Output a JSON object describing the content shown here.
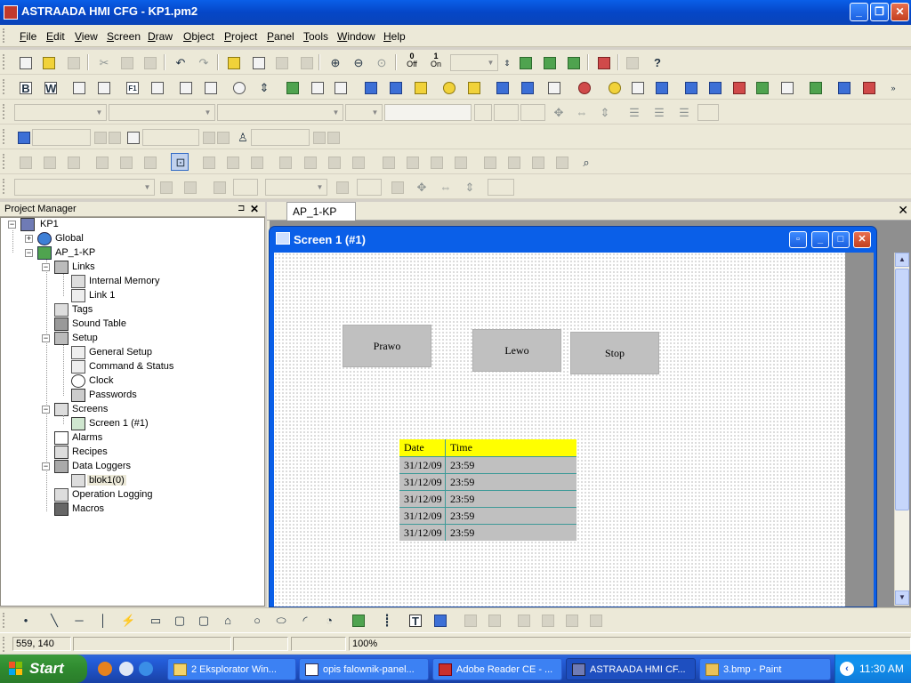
{
  "window": {
    "title": "ASTRAADA HMI CFG - KP1.pm2",
    "minimize": "_",
    "restore": "❐",
    "close": "✕"
  },
  "menu": [
    {
      "accel": "F",
      "rest": "ile"
    },
    {
      "accel": "E",
      "rest": "dit"
    },
    {
      "accel": "V",
      "rest": "iew"
    },
    {
      "accel": "S",
      "rest": "creen"
    },
    {
      "accel": "D",
      "rest": "raw"
    },
    {
      "accel": "O",
      "rest": "bject"
    },
    {
      "accel": "P",
      "rest": "roject"
    },
    {
      "accel": "P",
      "rest": "anel"
    },
    {
      "accel": "T",
      "rest": "ools"
    },
    {
      "accel": "W",
      "rest": "indow"
    },
    {
      "accel": "H",
      "rest": "elp"
    }
  ],
  "toolbar": {
    "off_label": "Off",
    "on_label": "On",
    "off_digit": "0",
    "on_digit": "1",
    "bold": "B",
    "w_label": "W",
    "f1_label": "F1"
  },
  "project_manager": {
    "title": "Project Manager",
    "pin": "⊐",
    "close": "✕",
    "tree": {
      "root": "KP1",
      "global": "Global",
      "panel": "AP_1-KP",
      "links": "Links",
      "internal_memory": "Internal Memory",
      "link1": "Link 1",
      "tags": "Tags",
      "sound_table": "Sound Table",
      "setup": "Setup",
      "general_setup": "General Setup",
      "command_status": "Command & Status",
      "clock": "Clock",
      "passwords": "Passwords",
      "screens": "Screens",
      "screen1": "Screen 1 (#1)",
      "alarms": "Alarms",
      "recipes": "Recipes",
      "data_loggers": "Data Loggers",
      "blok1": "blok1(0)",
      "operation_logging": "Operation Logging",
      "macros": "Macros"
    }
  },
  "document": {
    "tab": "AP_1-KP",
    "close": "✕",
    "screen_window": {
      "title": "Screen 1 (#1)",
      "buttons": {
        "prawo": "Prawo",
        "lewo": "Lewo",
        "stop": "Stop"
      },
      "table": {
        "headers": [
          "Date",
          "Time"
        ],
        "rows": [
          [
            "31/12/09",
            "23:59"
          ],
          [
            "31/12/09",
            "23:59"
          ],
          [
            "31/12/09",
            "23:59"
          ],
          [
            "31/12/09",
            "23:59"
          ],
          [
            "31/12/09",
            "23:59"
          ]
        ],
        "header_color": "#ffff00",
        "cell_color": "#c0c0c0"
      }
    }
  },
  "statusbar": {
    "coords": "559, 140",
    "zoom": "100%"
  },
  "taskbar": {
    "start": "Start",
    "tasks": [
      "2 Eksplorator Win...",
      "opis falownik-panel...",
      "Adobe Reader CE - ...",
      "ASTRAADA HMI CF...",
      "3.bmp - Paint"
    ],
    "clock": "11:30 AM"
  }
}
